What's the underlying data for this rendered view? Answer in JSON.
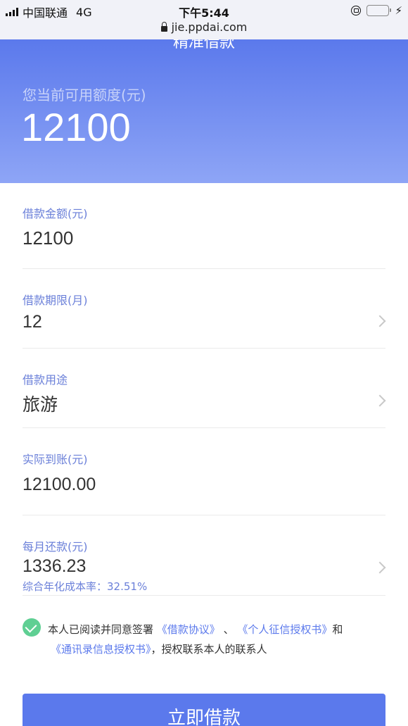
{
  "status_bar": {
    "carrier": "中国联通",
    "network": "4G",
    "time": "下午5:44",
    "url": "jie.ppdai.com"
  },
  "header": {
    "title": "精准借款",
    "available_label": "您当前可用额度(元)",
    "available_value": "12100"
  },
  "form": {
    "amount": {
      "label": "借款金额(元)",
      "value": "12100"
    },
    "term": {
      "label": "借款期限(月)",
      "value": "12"
    },
    "purpose": {
      "label": "借款用途",
      "value": "旅游"
    },
    "received": {
      "label": "实际到账(元)",
      "value": "12100.00"
    },
    "monthly": {
      "label": "每月还款(元)",
      "value": "1336.23",
      "apr_text": "综合年化成本率：32.51%"
    }
  },
  "agreement": {
    "checked": true,
    "prefix": "本人已阅读并同意签署",
    "link1": "《借款协议》",
    "sep1": "、",
    "link2": "《个人征信授权书》",
    "and": "和",
    "link3": "《通讯录信息授权书》",
    "suffix": "，授权联系本人的联系人"
  },
  "submit_label": "立即借款",
  "colors": {
    "accent": "#5b79ec",
    "label": "#6b80d9",
    "check": "#5fcf93"
  },
  "icons": [
    "lock-icon",
    "orientation-lock-icon",
    "battery-icon",
    "charging-bolt-icon",
    "chevron-right-icon",
    "check-icon"
  ]
}
